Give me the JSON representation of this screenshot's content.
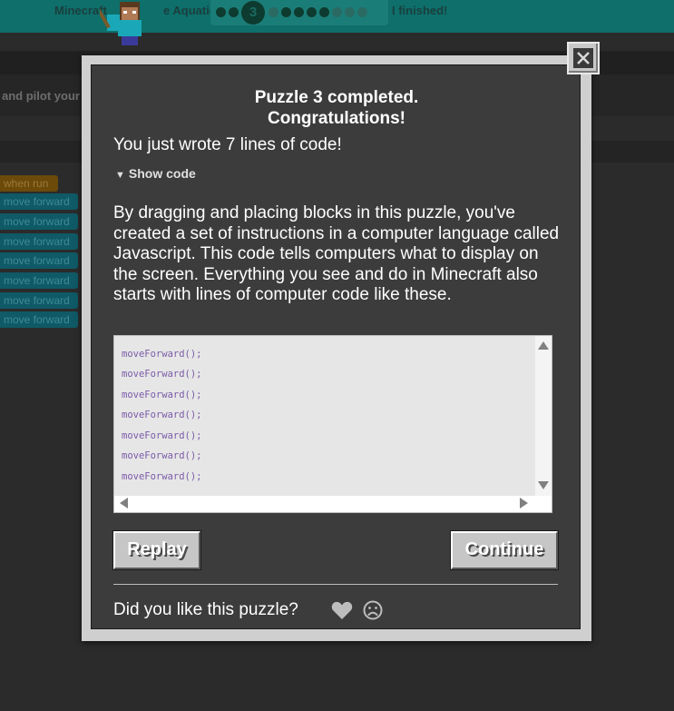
{
  "header": {
    "crumb_left": "Minecraft",
    "crumb_right": "e Aquatic",
    "current_level": "3",
    "finished_label": "I finished!"
  },
  "background": {
    "instruction_fragment": "and pilot your",
    "when_run_label": "when run",
    "blocks": [
      "move forward",
      "move forward",
      "move forward",
      "move forward",
      "move forward",
      "move forward",
      "move forward"
    ]
  },
  "modal": {
    "title_line1": "Puzzle 3 completed.",
    "title_line2": "Congratulations!",
    "lines_message": "You just wrote 7 lines of code!",
    "show_code_label": "Show code",
    "description": "By dragging and placing blocks in this puzzle, you've created a set of instructions in a computer language called Javascript. This code tells computers what to display on the screen. Everything you see and do in Minecraft also starts with lines of computer code like these.",
    "code_lines": [
      "moveForward();",
      "moveForward();",
      "moveForward();",
      "moveForward();",
      "moveForward();",
      "moveForward();",
      "moveForward();"
    ],
    "replay_label": "Replay",
    "continue_label": "Continue",
    "feedback_question": "Did you like this puzzle?"
  },
  "icons": {
    "close": "close-icon",
    "heart": "heart-icon",
    "frown": "frown-icon",
    "triangle": "triangle-down-icon"
  },
  "colors": {
    "modal_bg": "#3c3c3c",
    "modal_frame": "#cfcfcf",
    "code_text": "#7a5aa8",
    "button_face": "#c6c6c6"
  }
}
